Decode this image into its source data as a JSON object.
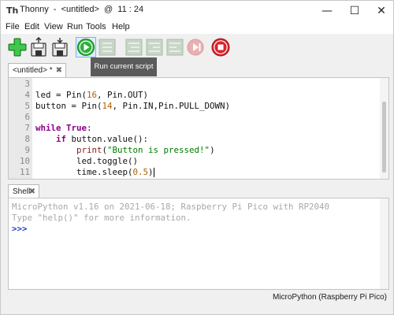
{
  "window": {
    "title": "Thonny  -  <untitled>  @  11 : 24",
    "minimize": "—",
    "maximize": "☐",
    "close": "✕"
  },
  "menu": [
    "File",
    "Edit",
    "View",
    "Run",
    "Tools",
    "Help"
  ],
  "toolbar": {
    "buttons": [
      "new-file",
      "open-file",
      "save-file",
      "run-script",
      "debug-script",
      "step-over",
      "step-into",
      "step-out",
      "resume",
      "stop"
    ],
    "tooltip": "Run current script",
    "colors": {
      "green": "#2db13a",
      "red": "#d9232b",
      "disabled": "#b9cbb9"
    }
  },
  "editor_tab": {
    "label": "<untitled> *",
    "close": "✖"
  },
  "editor": {
    "lines": [
      {
        "n": "3"
      },
      {
        "n": "4",
        "segs": [
          [
            "led = Pin(",
            ""
          ],
          [
            "16",
            "num"
          ],
          [
            ", Pin.OUT)",
            ""
          ]
        ]
      },
      {
        "n": "5",
        "segs": [
          [
            "button = Pin(",
            ""
          ],
          [
            "14",
            "num"
          ],
          [
            ", Pin.IN,Pin.PULL_DOWN)",
            ""
          ]
        ]
      },
      {
        "n": "6"
      },
      {
        "n": "7",
        "segs": [
          [
            "while",
            "kw"
          ],
          [
            " ",
            ""
          ],
          [
            "True",
            "kw"
          ],
          [
            ":",
            ""
          ]
        ]
      },
      {
        "n": "8",
        "segs": [
          [
            "    ",
            ""
          ],
          [
            "if",
            "kw"
          ],
          [
            " button.value():",
            ""
          ]
        ]
      },
      {
        "n": "9",
        "segs": [
          [
            "        ",
            ""
          ],
          [
            "print",
            "fn"
          ],
          [
            "(",
            ""
          ],
          [
            "\"Button is pressed!\"",
            "str"
          ],
          [
            ")",
            ""
          ]
        ]
      },
      {
        "n": "10",
        "segs": [
          [
            "        led.toggle()",
            ""
          ]
        ]
      },
      {
        "n": "11",
        "segs": [
          [
            "        time.sleep(",
            ""
          ],
          [
            "0.5",
            "num"
          ],
          [
            ")",
            ""
          ]
        ],
        "cursor": true
      }
    ]
  },
  "shell_tab": {
    "label": "Shell",
    "close": "✖"
  },
  "shell": {
    "banner": "MicroPython v1.16 on 2021-06-18; Raspberry Pi Pico with RP2040",
    "help": "Type \"help()\" for more information.",
    "prompt": ">>>"
  },
  "status": {
    "interpreter": "MicroPython (Raspberry Pi Pico)"
  }
}
